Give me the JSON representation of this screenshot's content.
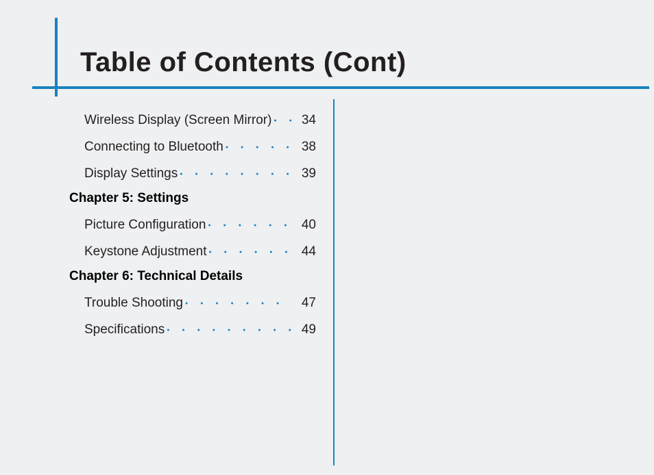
{
  "title": "Table of Contents (Cont)",
  "toc": {
    "section0": {
      "items": [
        {
          "label": "Wireless Display (Screen Mirror)",
          "page": "34"
        },
        {
          "label": "Connecting to Bluetooth",
          "page": "38"
        },
        {
          "label": "Display Settings",
          "page": "39"
        }
      ]
    },
    "chapter5": {
      "heading": "Chapter 5: Settings",
      "items": [
        {
          "label": "Picture Configuration",
          "page": "40"
        },
        {
          "label": "Keystone Adjustment",
          "page": "44"
        }
      ]
    },
    "chapter6": {
      "heading": "Chapter 6: Technical Details",
      "items": [
        {
          "label": "Trouble Shooting",
          "page": "47"
        },
        {
          "label": "Specifications",
          "page": "49"
        }
      ]
    }
  }
}
